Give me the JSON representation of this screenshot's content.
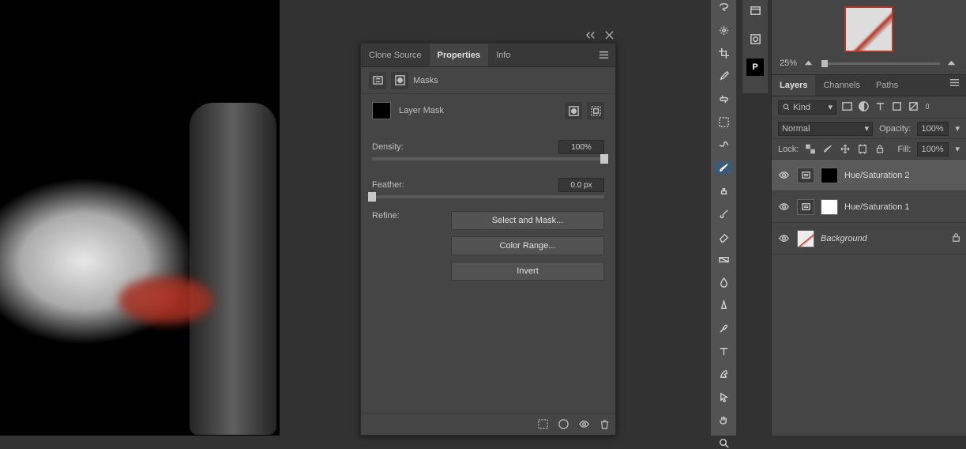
{
  "properties_panel": {
    "tabs": [
      "Clone Source",
      "Properties",
      "Info"
    ],
    "active_tab": "Properties",
    "header_label": "Masks",
    "mask_label": "Layer Mask",
    "density": {
      "label": "Density:",
      "value": "100%",
      "position": 100
    },
    "feather": {
      "label": "Feather:",
      "value": "0.0 px",
      "position": 0
    },
    "refine": {
      "label": "Refine:",
      "buttons": [
        "Select and Mask...",
        "Color Range...",
        "Invert"
      ]
    }
  },
  "navigator": {
    "zoom": "25%"
  },
  "layers_panel": {
    "tabs": [
      "Layers",
      "Channels",
      "Paths"
    ],
    "active_tab": "Layers",
    "kind_filter": "Kind",
    "blend_mode": "Normal",
    "opacity": {
      "label": "Opacity:",
      "value": "100%"
    },
    "lock_label": "Lock:",
    "fill": {
      "label": "Fill:",
      "value": "100%"
    },
    "layers": [
      {
        "name": "Hue/Saturation 2",
        "type": "adjustment",
        "mask": "black",
        "visible": true,
        "selected": true
      },
      {
        "name": "Hue/Saturation 1",
        "type": "adjustment",
        "mask": "white",
        "visible": true,
        "selected": false
      },
      {
        "name": "Background",
        "type": "bg",
        "locked": true,
        "visible": true,
        "selected": false
      }
    ]
  }
}
